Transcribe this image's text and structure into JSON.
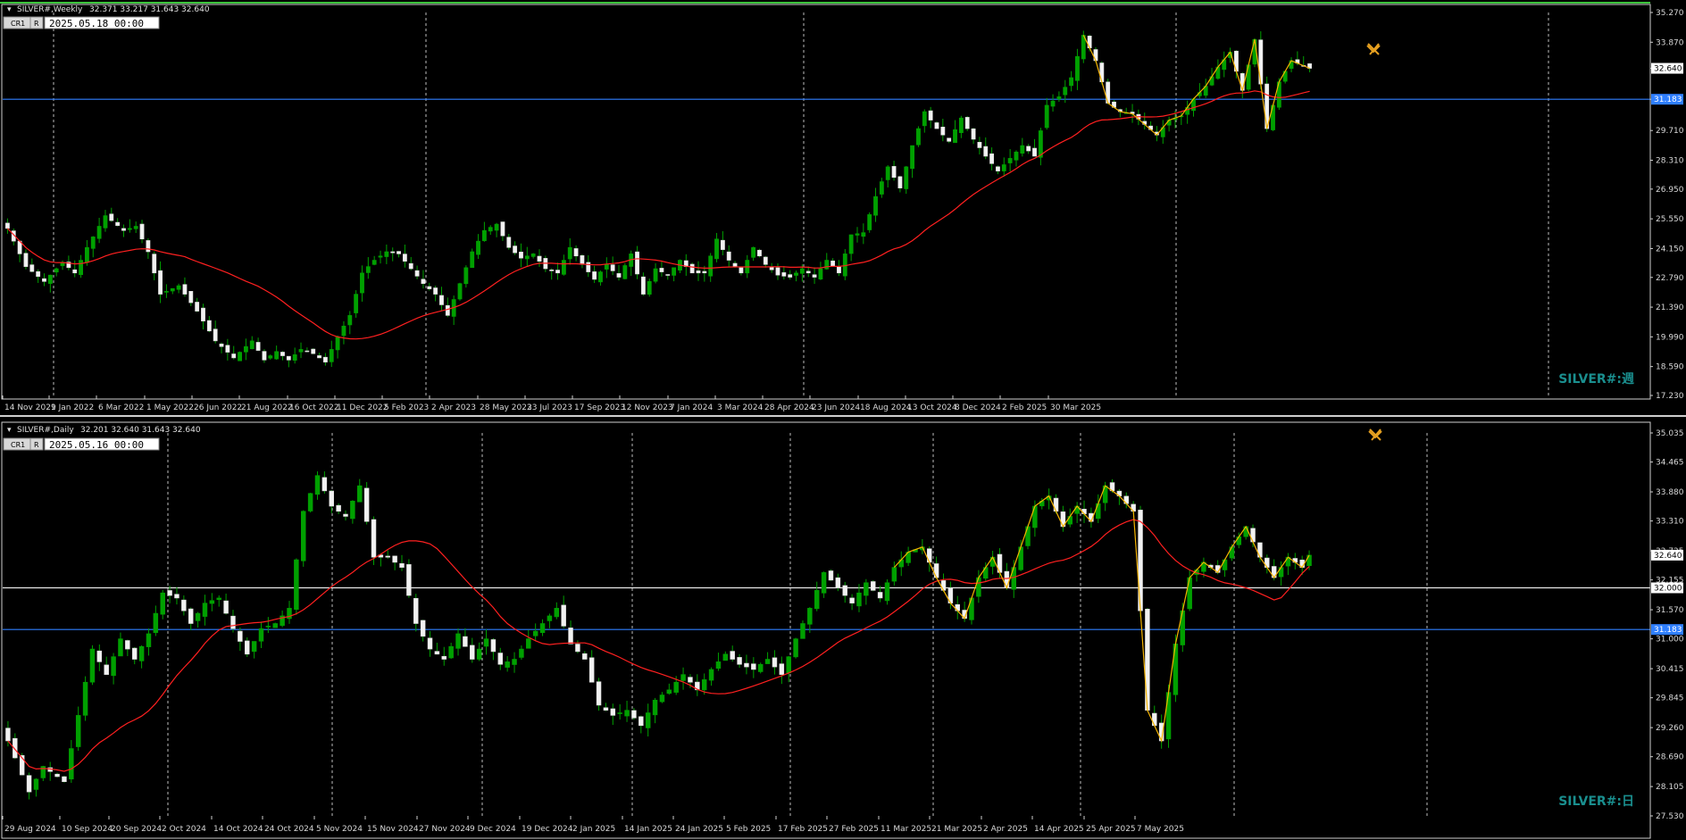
{
  "chart_data": [
    {
      "type": "candlestick",
      "title": "SILVER#,Weekly",
      "ohlc_label": "32.371 33.217 31.643 32.640",
      "datetime_box": "2025.05.18 00:00",
      "button_cr1": "CR1",
      "button_r": "R",
      "watermark": "SILVER#:週",
      "ylim": [
        17.23,
        35.27
      ],
      "y_ticks": [
        "35.270",
        "33.870",
        "32.640",
        "31.183",
        "29.710",
        "28.310",
        "26.950",
        "25.550",
        "24.150",
        "22.790",
        "21.390",
        "19.990",
        "18.590",
        "17.230"
      ],
      "x_ticks": [
        "14 Nov 2021",
        "9 Jan 2022",
        "6 Mar 2022",
        "1 May 2022",
        "26 Jun 2022",
        "21 Aug 2022",
        "16 Oct 2022",
        "11 Dec 2022",
        "5 Feb 2023",
        "2 Apr 2023",
        "28 May 2023",
        "23 Jul 2023",
        "17 Sep 2023",
        "12 Nov 2023",
        "7 Jan 2024",
        "3 Mar 2024",
        "28 Apr 2024",
        "23 Jun 2024",
        "18 Aug 2024",
        "13 Oct 2024",
        "8 Dec 2024",
        "2 Feb 2025",
        "30 Mar 2025"
      ],
      "x_range_weeks": [
        0,
        213
      ],
      "price_label": "32.640",
      "hline": {
        "value": 31.183,
        "label": "31.183",
        "color": "#2f7fff"
      },
      "ma_color": "#ff2020",
      "zigzag_color": "#f5b400",
      "up_color": "#00a000",
      "down_color": "#f2f2f2",
      "close_anchors": [
        {
          "i": 0,
          "c": 25.1
        },
        {
          "i": 3,
          "c": 23.3
        },
        {
          "i": 6,
          "c": 22.6
        },
        {
          "i": 9,
          "c": 23.5
        },
        {
          "i": 11,
          "c": 23.0
        },
        {
          "i": 13,
          "c": 24.2
        },
        {
          "i": 16,
          "c": 25.7
        },
        {
          "i": 19,
          "c": 25.0
        },
        {
          "i": 21,
          "c": 25.2
        },
        {
          "i": 23,
          "c": 24.0
        },
        {
          "i": 25,
          "c": 22.0
        },
        {
          "i": 28,
          "c": 22.4
        },
        {
          "i": 31,
          "c": 21.2
        },
        {
          "i": 34,
          "c": 19.8
        },
        {
          "i": 37,
          "c": 19.0
        },
        {
          "i": 40,
          "c": 19.8
        },
        {
          "i": 42,
          "c": 18.9
        },
        {
          "i": 44,
          "c": 19.3
        },
        {
          "i": 46,
          "c": 18.9
        },
        {
          "i": 48,
          "c": 19.4
        },
        {
          "i": 50,
          "c": 19.2
        },
        {
          "i": 52,
          "c": 18.8
        },
        {
          "i": 54,
          "c": 20.0
        },
        {
          "i": 56,
          "c": 21.0
        },
        {
          "i": 58,
          "c": 23.0
        },
        {
          "i": 60,
          "c": 23.6
        },
        {
          "i": 62,
          "c": 24.0
        },
        {
          "i": 64,
          "c": 23.9
        },
        {
          "i": 66,
          "c": 23.2
        },
        {
          "i": 68,
          "c": 22.5
        },
        {
          "i": 70,
          "c": 22.0
        },
        {
          "i": 72,
          "c": 21.0
        },
        {
          "i": 74,
          "c": 22.5
        },
        {
          "i": 76,
          "c": 24.0
        },
        {
          "i": 78,
          "c": 25.0
        },
        {
          "i": 80,
          "c": 25.3
        },
        {
          "i": 82,
          "c": 24.2
        },
        {
          "i": 84,
          "c": 23.7
        },
        {
          "i": 86,
          "c": 23.9
        },
        {
          "i": 88,
          "c": 23.2
        },
        {
          "i": 90,
          "c": 23.0
        },
        {
          "i": 92,
          "c": 24.2
        },
        {
          "i": 94,
          "c": 23.4
        },
        {
          "i": 96,
          "c": 22.7
        },
        {
          "i": 98,
          "c": 23.4
        },
        {
          "i": 100,
          "c": 22.8
        },
        {
          "i": 102,
          "c": 23.9
        },
        {
          "i": 104,
          "c": 22.0
        },
        {
          "i": 106,
          "c": 23.2
        },
        {
          "i": 108,
          "c": 22.9
        },
        {
          "i": 110,
          "c": 23.6
        },
        {
          "i": 112,
          "c": 23.0
        },
        {
          "i": 114,
          "c": 23.0
        },
        {
          "i": 116,
          "c": 24.6
        },
        {
          "i": 118,
          "c": 23.6
        },
        {
          "i": 120,
          "c": 23.0
        },
        {
          "i": 122,
          "c": 24.2
        },
        {
          "i": 124,
          "c": 23.4
        },
        {
          "i": 126,
          "c": 22.9
        },
        {
          "i": 128,
          "c": 22.8
        },
        {
          "i": 130,
          "c": 23.2
        },
        {
          "i": 132,
          "c": 22.8
        },
        {
          "i": 134,
          "c": 23.6
        },
        {
          "i": 136,
          "c": 23.0
        },
        {
          "i": 138,
          "c": 24.8
        },
        {
          "i": 140,
          "c": 24.9
        },
        {
          "i": 142,
          "c": 26.6
        },
        {
          "i": 144,
          "c": 28.0
        },
        {
          "i": 146,
          "c": 27.0
        },
        {
          "i": 148,
          "c": 29.0
        },
        {
          "i": 150,
          "c": 30.6
        },
        {
          "i": 152,
          "c": 29.8
        },
        {
          "i": 154,
          "c": 29.2
        },
        {
          "i": 156,
          "c": 30.3
        },
        {
          "i": 158,
          "c": 29.3
        },
        {
          "i": 160,
          "c": 28.5
        },
        {
          "i": 162,
          "c": 27.8
        },
        {
          "i": 164,
          "c": 28.4
        },
        {
          "i": 166,
          "c": 29.0
        },
        {
          "i": 168,
          "c": 28.5
        },
        {
          "i": 170,
          "c": 30.9
        },
        {
          "i": 172,
          "c": 31.3
        },
        {
          "i": 174,
          "c": 32.2
        },
        {
          "i": 176,
          "c": 34.2
        },
        {
          "i": 178,
          "c": 33.0
        },
        {
          "i": 180,
          "c": 31.0
        },
        {
          "i": 182,
          "c": 30.6
        },
        {
          "i": 184,
          "c": 30.5
        },
        {
          "i": 186,
          "c": 30.0
        },
        {
          "i": 188,
          "c": 29.5
        },
        {
          "i": 190,
          "c": 30.2
        },
        {
          "i": 192,
          "c": 30.4
        },
        {
          "i": 194,
          "c": 31.2
        },
        {
          "i": 196,
          "c": 31.8
        },
        {
          "i": 198,
          "c": 32.7
        },
        {
          "i": 200,
          "c": 33.4
        },
        {
          "i": 202,
          "c": 31.6
        },
        {
          "i": 204,
          "c": 34.0
        },
        {
          "i": 206,
          "c": 29.8
        },
        {
          "i": 208,
          "c": 32.0
        },
        {
          "i": 210,
          "c": 33.0
        },
        {
          "i": 213,
          "c": 32.64
        }
      ]
    },
    {
      "type": "candlestick",
      "title": "SILVER#,Daily",
      "ohlc_label": "32.201 32.640 31.643 32.640",
      "datetime_box": "2025.05.16 00:00",
      "button_cr1": "CR1",
      "button_r": "R",
      "watermark": "SILVER#:日",
      "ylim": [
        27.53,
        35.035
      ],
      "y_ticks": [
        "35.035",
        "34.465",
        "33.880",
        "33.310",
        "32.725",
        "32.155",
        "31.570",
        "31.000",
        "30.415",
        "29.845",
        "29.260",
        "28.690",
        "28.105",
        "27.530"
      ],
      "x_ticks": [
        "29 Aug 2024",
        "10 Sep 2024",
        "20 Sep 2024",
        "2 Oct 2024",
        "14 Oct 2024",
        "24 Oct 2024",
        "5 Nov 2024",
        "15 Nov 2024",
        "27 Nov 2024",
        "9 Dec 2024",
        "19 Dec 2024",
        "2 Jan 2025",
        "14 Jan 2025",
        "24 Jan 2025",
        "5 Feb 2025",
        "17 Feb 2025",
        "27 Feb 2025",
        "11 Mar 2025",
        "21 Mar 2025",
        "2 Apr 2025",
        "14 Apr 2025",
        "25 Apr 2025",
        "7 May 2025"
      ],
      "x_range_days": [
        0,
        185
      ],
      "price_label": "32.640",
      "hline_white": {
        "value": 32.0,
        "label": "32.000",
        "color": "#e8e8e8"
      },
      "hline": {
        "value": 31.183,
        "label": "31.183",
        "color": "#2f7fff"
      },
      "ma_color": "#ff2020",
      "zigzag_color": "#f5b400",
      "up_color": "#00a000",
      "down_color": "#f2f2f2",
      "close_anchors": [
        {
          "i": 0,
          "c": 29.0
        },
        {
          "i": 3,
          "c": 28.0
        },
        {
          "i": 5,
          "c": 28.5
        },
        {
          "i": 8,
          "c": 28.2
        },
        {
          "i": 10,
          "c": 29.5
        },
        {
          "i": 12,
          "c": 30.8
        },
        {
          "i": 14,
          "c": 30.3
        },
        {
          "i": 16,
          "c": 31.0
        },
        {
          "i": 18,
          "c": 30.6
        },
        {
          "i": 20,
          "c": 31.1
        },
        {
          "i": 22,
          "c": 31.9
        },
        {
          "i": 24,
          "c": 31.8
        },
        {
          "i": 26,
          "c": 31.3
        },
        {
          "i": 28,
          "c": 31.7
        },
        {
          "i": 30,
          "c": 31.8
        },
        {
          "i": 32,
          "c": 31.2
        },
        {
          "i": 34,
          "c": 30.7
        },
        {
          "i": 36,
          "c": 31.2
        },
        {
          "i": 38,
          "c": 31.3
        },
        {
          "i": 40,
          "c": 31.6
        },
        {
          "i": 42,
          "c": 33.5
        },
        {
          "i": 44,
          "c": 34.2
        },
        {
          "i": 46,
          "c": 33.6
        },
        {
          "i": 48,
          "c": 33.4
        },
        {
          "i": 50,
          "c": 34.0
        },
        {
          "i": 52,
          "c": 32.6
        },
        {
          "i": 54,
          "c": 32.6
        },
        {
          "i": 56,
          "c": 32.4
        },
        {
          "i": 58,
          "c": 31.3
        },
        {
          "i": 60,
          "c": 30.8
        },
        {
          "i": 62,
          "c": 30.6
        },
        {
          "i": 64,
          "c": 31.1
        },
        {
          "i": 66,
          "c": 30.6
        },
        {
          "i": 68,
          "c": 31.0
        },
        {
          "i": 70,
          "c": 30.5
        },
        {
          "i": 72,
          "c": 30.6
        },
        {
          "i": 74,
          "c": 31.0
        },
        {
          "i": 76,
          "c": 31.3
        },
        {
          "i": 78,
          "c": 31.6
        },
        {
          "i": 80,
          "c": 30.9
        },
        {
          "i": 82,
          "c": 30.6
        },
        {
          "i": 84,
          "c": 29.7
        },
        {
          "i": 86,
          "c": 29.5
        },
        {
          "i": 88,
          "c": 29.6
        },
        {
          "i": 90,
          "c": 29.3
        },
        {
          "i": 92,
          "c": 29.8
        },
        {
          "i": 94,
          "c": 30.0
        },
        {
          "i": 96,
          "c": 30.3
        },
        {
          "i": 98,
          "c": 30.0
        },
        {
          "i": 100,
          "c": 30.4
        },
        {
          "i": 102,
          "c": 30.7
        },
        {
          "i": 104,
          "c": 30.5
        },
        {
          "i": 106,
          "c": 30.4
        },
        {
          "i": 108,
          "c": 30.6
        },
        {
          "i": 110,
          "c": 30.3
        },
        {
          "i": 112,
          "c": 31.0
        },
        {
          "i": 114,
          "c": 31.6
        },
        {
          "i": 116,
          "c": 32.3
        },
        {
          "i": 118,
          "c": 32.0
        },
        {
          "i": 120,
          "c": 31.7
        },
        {
          "i": 122,
          "c": 32.1
        },
        {
          "i": 124,
          "c": 31.8
        },
        {
          "i": 126,
          "c": 32.4
        },
        {
          "i": 128,
          "c": 32.7
        },
        {
          "i": 130,
          "c": 32.8
        },
        {
          "i": 132,
          "c": 32.2
        },
        {
          "i": 134,
          "c": 31.7
        },
        {
          "i": 136,
          "c": 31.4
        },
        {
          "i": 138,
          "c": 32.2
        },
        {
          "i": 140,
          "c": 32.6
        },
        {
          "i": 142,
          "c": 32.0
        },
        {
          "i": 144,
          "c": 32.8
        },
        {
          "i": 146,
          "c": 33.6
        },
        {
          "i": 148,
          "c": 33.8
        },
        {
          "i": 150,
          "c": 33.2
        },
        {
          "i": 152,
          "c": 33.6
        },
        {
          "i": 154,
          "c": 33.3
        },
        {
          "i": 156,
          "c": 34.0
        },
        {
          "i": 158,
          "c": 33.8
        },
        {
          "i": 160,
          "c": 33.5
        },
        {
          "i": 162,
          "c": 29.6
        },
        {
          "i": 164,
          "c": 29.0
        },
        {
          "i": 166,
          "c": 30.9
        },
        {
          "i": 168,
          "c": 32.2
        },
        {
          "i": 170,
          "c": 32.5
        },
        {
          "i": 172,
          "c": 32.3
        },
        {
          "i": 174,
          "c": 32.8
        },
        {
          "i": 176,
          "c": 33.2
        },
        {
          "i": 178,
          "c": 32.6
        },
        {
          "i": 180,
          "c": 32.2
        },
        {
          "i": 182,
          "c": 32.6
        },
        {
          "i": 184,
          "c": 32.4
        },
        {
          "i": 185,
          "c": 32.64
        }
      ]
    }
  ]
}
